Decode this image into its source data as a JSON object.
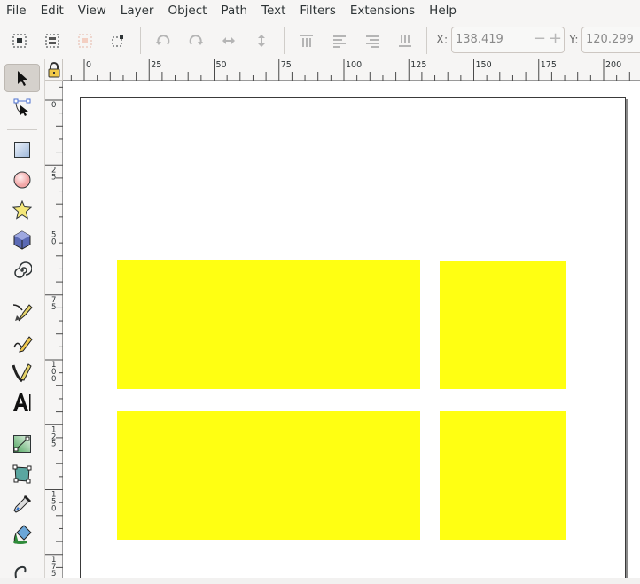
{
  "menu": [
    "File",
    "Edit",
    "View",
    "Layer",
    "Object",
    "Path",
    "Text",
    "Filters",
    "Extensions",
    "Help"
  ],
  "toolbar": {
    "buttons": [
      "select-all-icon",
      "select-all-layers-icon",
      "invert-selection-icon",
      "deselect-icon",
      "rotate-ccw-icon",
      "rotate-cw-icon",
      "flip-horizontal-icon",
      "flip-vertical-icon",
      "raise-to-top-icon",
      "raise-icon",
      "lower-icon",
      "lower-to-bottom-icon"
    ],
    "x_label": "X:",
    "x_value": "138.419",
    "y_label": "Y:",
    "y_value": "120.299"
  },
  "tools": [
    "selector-tool",
    "node-tool",
    "rectangle-tool",
    "ellipse-tool",
    "star-tool",
    "3d-box-tool",
    "spiral-tool",
    "pen-tool",
    "pencil-tool",
    "calligraphy-tool",
    "text-tool",
    "gradient-tool",
    "mesh-tool",
    "dropper-tool",
    "paint-bucket-tool",
    "tweak-tool"
  ],
  "ruler_top_labels": [
    "0",
    "25",
    "50",
    "75",
    "100",
    "125",
    "150",
    "175",
    "200"
  ],
  "ruler_left_labels": [
    "0",
    "25",
    "50",
    "75",
    "100",
    "125",
    "150",
    "175"
  ],
  "colors": {
    "rect_fill": "#ffff12",
    "accent": "#ffd700"
  }
}
